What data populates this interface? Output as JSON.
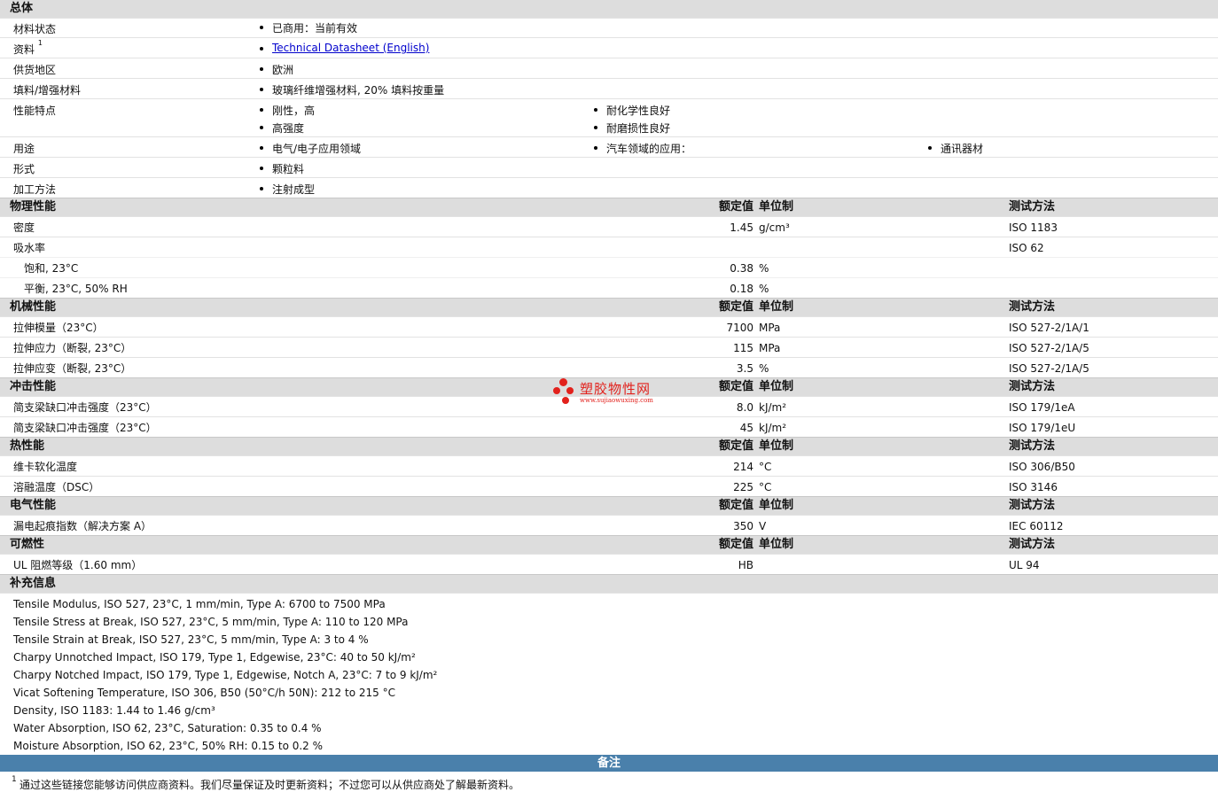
{
  "general": {
    "title": "总体",
    "material_status": {
      "label": "材料状态",
      "value": "已商用：当前有效"
    },
    "literature": {
      "label": "资料",
      "sup": "1",
      "link": "Technical Datasheet (English)"
    },
    "availability": {
      "label": "供货地区",
      "value": "欧洲"
    },
    "filler": {
      "label": "填料/增强材料",
      "value": "玻璃纤维增强材料, 20% 填料按重量"
    },
    "features": {
      "label": "性能特点",
      "items": [
        "刚性，高",
        "耐化学性良好",
        "高强度",
        "耐磨损性良好"
      ]
    },
    "uses": {
      "label": "用途",
      "items": [
        "电气/电子应用领域",
        "汽车领域的应用：",
        "通讯器材"
      ]
    },
    "forms": {
      "label": "形式",
      "value": "颗粒料"
    },
    "processing": {
      "label": "加工方法",
      "value": "注射成型"
    }
  },
  "headers": {
    "nominal": "额定值",
    "unit": "单位制",
    "method": "测试方法"
  },
  "physical": {
    "title": "物理性能",
    "rows": [
      {
        "label": "密度",
        "value": "1.45",
        "unit": "g/cm³",
        "method": "ISO 1183"
      },
      {
        "label": "吸水率",
        "value": "",
        "unit": "",
        "method": "ISO 62"
      },
      {
        "label": "饱和, 23°C",
        "value": "0.38",
        "unit": "%",
        "method": ""
      },
      {
        "label": "平衡, 23°C, 50% RH",
        "value": "0.18",
        "unit": "%",
        "method": ""
      }
    ]
  },
  "mechanical": {
    "title": "机械性能",
    "rows": [
      {
        "label": "拉伸模量（23°C）",
        "value": "7100",
        "unit": "MPa",
        "method": "ISO 527-2/1A/1"
      },
      {
        "label": "拉伸应力（断裂, 23°C）",
        "value": "115",
        "unit": "MPa",
        "method": "ISO 527-2/1A/5"
      },
      {
        "label": "拉伸应变（断裂, 23°C）",
        "value": "3.5",
        "unit": "%",
        "method": "ISO 527-2/1A/5"
      }
    ]
  },
  "impact": {
    "title": "冲击性能",
    "rows": [
      {
        "label": "简支梁缺口冲击强度（23°C）",
        "value": "8.0",
        "unit": "kJ/m²",
        "method": "ISO 179/1eA"
      },
      {
        "label": "简支梁缺口冲击强度（23°C）",
        "value": "45",
        "unit": "kJ/m²",
        "method": "ISO 179/1eU"
      }
    ]
  },
  "thermal": {
    "title": "热性能",
    "rows": [
      {
        "label": "维卡软化温度",
        "value": "214",
        "unit": "°C",
        "method": "ISO 306/B50"
      },
      {
        "label": "溶融温度（DSC）",
        "value": "225",
        "unit": "°C",
        "method": "ISO 3146"
      }
    ]
  },
  "electrical": {
    "title": "电气性能",
    "rows": [
      {
        "label": "漏电起痕指数（解决方案 A）",
        "value": "350",
        "unit": "V",
        "method": "IEC 60112"
      }
    ]
  },
  "flammability": {
    "title": "可燃性",
    "rows": [
      {
        "label": "UL 阻燃等级（1.60 mm）",
        "value": "HB",
        "unit": "",
        "method": "UL 94"
      }
    ]
  },
  "supplemental": {
    "title": "补充信息",
    "lines": [
      "Tensile Modulus, ISO 527, 23°C, 1 mm/min, Type A: 6700 to 7500 MPa",
      "Tensile Stress at Break, ISO 527, 23°C, 5 mm/min, Type A: 110 to 120 MPa",
      "Tensile Strain at Break, ISO 527, 23°C, 5 mm/min, Type A: 3 to 4 %",
      "Charpy Unnotched Impact, ISO 179, Type 1, Edgewise, 23°C: 40 to 50 kJ/m²",
      "Charpy Notched Impact, ISO 179, Type 1, Edgewise, Notch A, 23°C: 7 to 9 kJ/m²",
      "Vicat Softening Temperature, ISO 306, B50 (50°C/h 50N): 212 to 215 °C",
      "Density, ISO 1183: 1.44 to 1.46 g/cm³",
      "Water Absorption, ISO 62, 23°C, Saturation: 0.35 to 0.4 %",
      "Moisture Absorption, ISO 62, 23°C, 50% RH: 0.15 to 0.2 %"
    ]
  },
  "notes": {
    "title": "备注",
    "footnote_mark": "1",
    "footnote": "通过这些链接您能够访问供应商资料。我们尽量保证及时更新资料；不过您可以从供应商处了解最新资料。"
  },
  "watermark": {
    "name": "塑胶物性网",
    "url": "www.sujiaowuxing.com",
    "color": "#e2211c"
  }
}
